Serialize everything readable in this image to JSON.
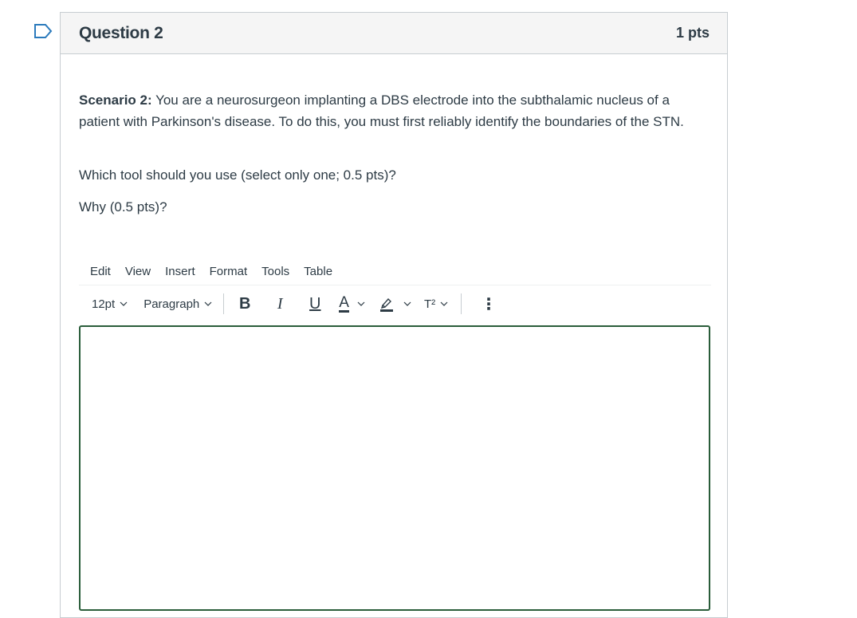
{
  "question": {
    "title": "Question 2",
    "points": "1 pts",
    "scenario_label": "Scenario 2:",
    "scenario_text": " You are a neurosurgeon implanting a DBS electrode into the subthalamic nucleus of a patient with Parkinson's disease. To do this, you must first reliably identify the boundaries of the STN.",
    "prompt_1": "Which tool should you use (select only one; 0.5 pts)?",
    "prompt_2": "Why (0.5 pts)?"
  },
  "editor": {
    "menu": [
      "Edit",
      "View",
      "Insert",
      "Format",
      "Tools",
      "Table"
    ],
    "font_size": "12pt",
    "block_format": "Paragraph",
    "bold_label": "B",
    "italic_label": "I",
    "underline_label": "U",
    "text_color_label": "A",
    "superscript_label": "T²",
    "more_label": "⋮",
    "content": ""
  },
  "colors": {
    "flag": "#2b7abc",
    "editor_border": "#2a5d3a",
    "header_bg": "#f5f5f5"
  },
  "icons": [
    "flag-icon",
    "chevron-down-icon",
    "highlight-pen-icon",
    "more-vertical-icon"
  ]
}
